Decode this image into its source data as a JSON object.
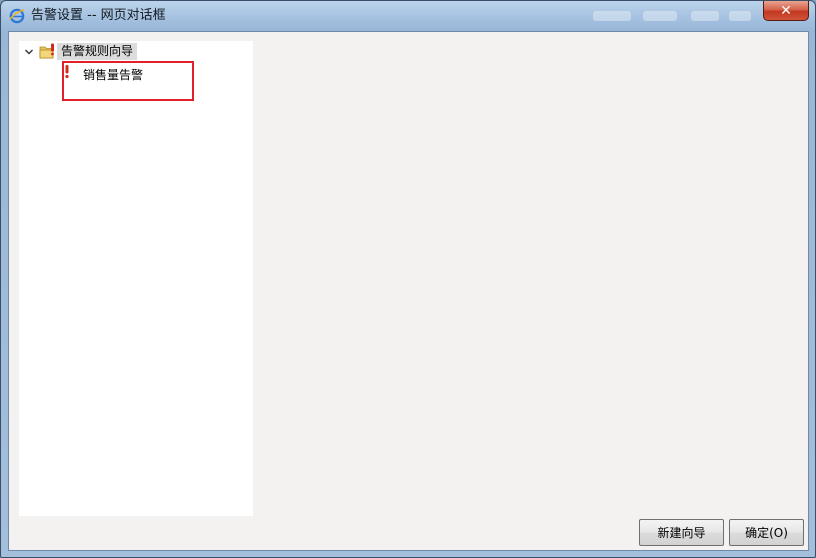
{
  "window": {
    "title": "告警设置 -- 网页对话框",
    "close_label": "✕"
  },
  "tree": {
    "root": {
      "label": "告警规则向导",
      "expanded": true
    },
    "children": [
      {
        "label": "销售量告警"
      }
    ]
  },
  "buttons": {
    "new_wizard": "新建向导",
    "ok": "确定(O)"
  },
  "colors": {
    "highlight_border": "#e0202a",
    "tree_selection": "#dcdcdc",
    "alert_icon": "#d22a1e",
    "folder_icon": "#e8c35a"
  }
}
